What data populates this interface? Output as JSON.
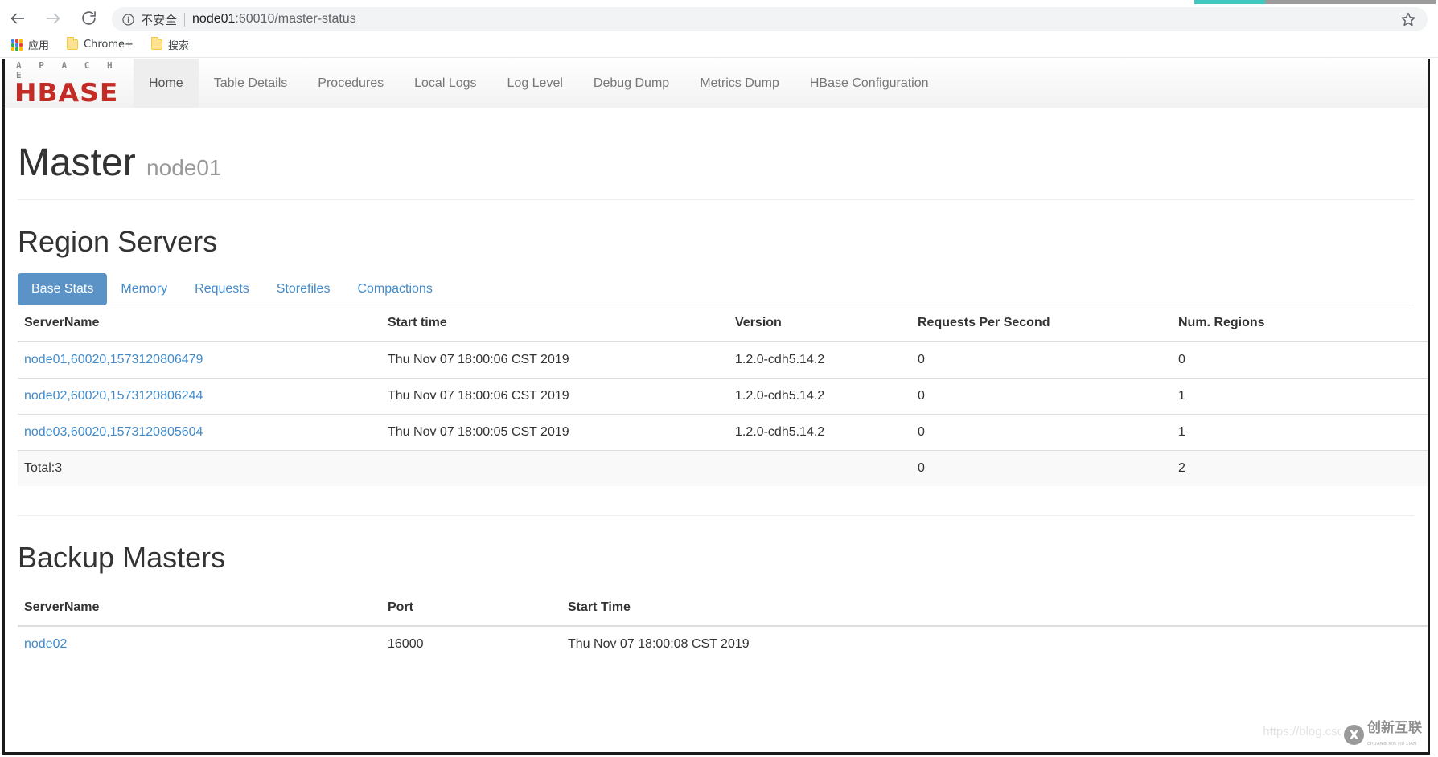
{
  "browser": {
    "back_icon": "back-arrow-icon",
    "forward_icon": "forward-arrow-icon",
    "reload_icon": "reload-icon",
    "security_label": "不安全",
    "url_host": "node01",
    "url_rest": ":60010/master-status",
    "star_icon": "bookmark-star-icon",
    "bookmarks": [
      {
        "label": "应用",
        "icon": "apps-grid-icon"
      },
      {
        "label": "Chrome+",
        "icon": "folder-icon"
      },
      {
        "label": "搜索",
        "icon": "folder-icon"
      }
    ]
  },
  "navbar": {
    "brand_top": "A P A C H E",
    "brand_main": "HBASE",
    "items": [
      {
        "label": "Home",
        "active": true
      },
      {
        "label": "Table Details",
        "active": false
      },
      {
        "label": "Procedures",
        "active": false
      },
      {
        "label": "Local Logs",
        "active": false
      },
      {
        "label": "Log Level",
        "active": false
      },
      {
        "label": "Debug Dump",
        "active": false
      },
      {
        "label": "Metrics Dump",
        "active": false
      },
      {
        "label": "HBase Configuration",
        "active": false
      }
    ]
  },
  "header": {
    "title": "Master",
    "subtitle": "node01"
  },
  "region_servers": {
    "heading": "Region Servers",
    "tabs": [
      {
        "label": "Base Stats",
        "active": true
      },
      {
        "label": "Memory",
        "active": false
      },
      {
        "label": "Requests",
        "active": false
      },
      {
        "label": "Storefiles",
        "active": false
      },
      {
        "label": "Compactions",
        "active": false
      }
    ],
    "columns": [
      "ServerName",
      "Start time",
      "Version",
      "Requests Per Second",
      "Num. Regions"
    ],
    "rows": [
      {
        "server_name": "node01,60020,1573120806479",
        "start_time": "Thu Nov 07 18:00:06 CST 2019",
        "version": "1.2.0-cdh5.14.2",
        "requests_per_second": "0",
        "num_regions": "0"
      },
      {
        "server_name": "node02,60020,1573120806244",
        "start_time": "Thu Nov 07 18:00:06 CST 2019",
        "version": "1.2.0-cdh5.14.2",
        "requests_per_second": "0",
        "num_regions": "1"
      },
      {
        "server_name": "node03,60020,1573120805604",
        "start_time": "Thu Nov 07 18:00:05 CST 2019",
        "version": "1.2.0-cdh5.14.2",
        "requests_per_second": "0",
        "num_regions": "1"
      }
    ],
    "total": {
      "label": "Total:3",
      "start_time": "",
      "version": "",
      "requests_per_second": "0",
      "num_regions": "2"
    }
  },
  "backup_masters": {
    "heading": "Backup Masters",
    "columns": [
      "ServerName",
      "Port",
      "Start Time"
    ],
    "rows": [
      {
        "server_name": "node02",
        "port": "16000",
        "start_time": "Thu Nov 07 18:00:08 CST 2019"
      }
    ]
  },
  "watermarks": {
    "csdn": "https://blog.csdn.net/q",
    "badge_cn": "创新互联",
    "badge_en": "CHUANG XIN HU LIAN",
    "badge_mark": "X"
  },
  "colors": {
    "brand_red": "#c32b24",
    "link_blue": "#428bca",
    "tab_active_bg": "#5b93c7",
    "text": "#333333"
  }
}
